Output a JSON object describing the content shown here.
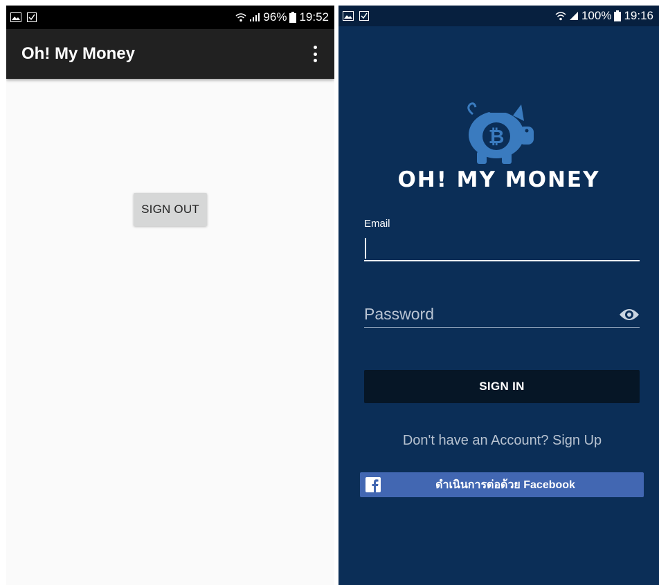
{
  "left_screen": {
    "status_bar": {
      "battery": "96%",
      "time": "19:52"
    },
    "app_bar": {
      "title": "Oh! My Money"
    },
    "sign_out_label": "SIGN OUT"
  },
  "right_screen": {
    "status_bar": {
      "battery": "100%",
      "time": "19:16"
    },
    "brand": "OH! MY MONEY",
    "email": {
      "label": "Email",
      "value": ""
    },
    "password": {
      "placeholder": "Password"
    },
    "sign_in_label": "SIGN IN",
    "sign_up_text": "Don't have an Account? Sign Up",
    "facebook_label": "ดำเนินการต่อด้วย Facebook",
    "icons": [
      "gallery-icon",
      "task-icon",
      "wifi-icon",
      "signal-icon",
      "battery-icon",
      "piggy-bank-logo-icon",
      "eye-icon",
      "facebook-icon"
    ],
    "colors": {
      "background": "#0b2e57",
      "logo": "#3a7bbf",
      "facebook": "#4267b2",
      "sign_in_button": "#061626"
    }
  }
}
